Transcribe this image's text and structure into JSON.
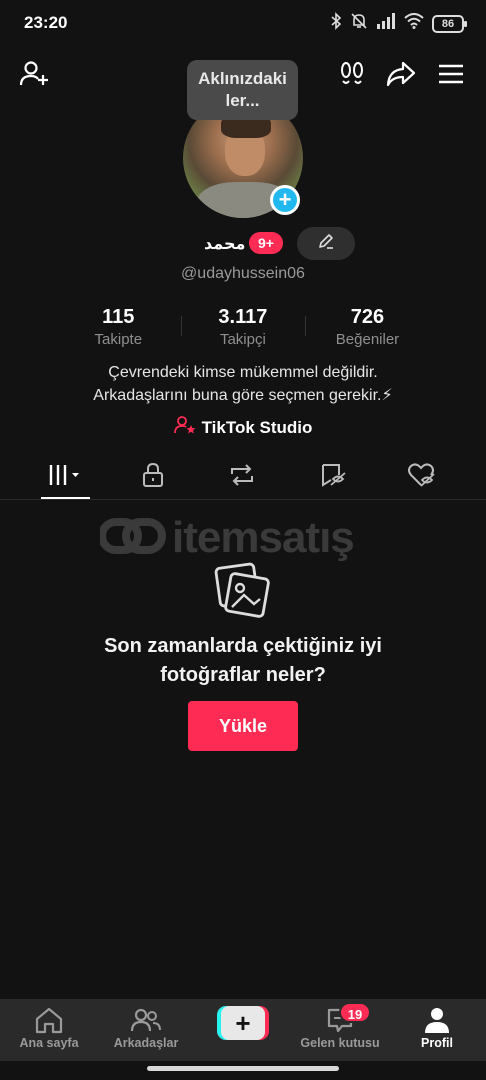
{
  "status_bar": {
    "time": "23:20",
    "battery": "86",
    "icons": [
      "bluetooth-icon",
      "mute-icon",
      "signal-icon",
      "wifi-icon",
      "battery-icon"
    ]
  },
  "header": {
    "tooltip": "Aklınızdaki ler...",
    "icons": [
      "add-friend-icon",
      "footprints-icon",
      "share-icon",
      "menu-icon"
    ]
  },
  "profile": {
    "display_name": "محمد",
    "name_badge": "9+",
    "username": "@udayhussein06"
  },
  "stats": [
    {
      "value": "115",
      "label": "Takipte"
    },
    {
      "value": "3.117",
      "label": "Takipçi"
    },
    {
      "value": "726",
      "label": "Beğeniler"
    }
  ],
  "bio": {
    "line1": "Çevrendeki kimse mükemmel değildir.",
    "line2": "Arkadaşlarını buna göre seçmen gerekir.⚡"
  },
  "studio": {
    "label": "TikTok Studio"
  },
  "tabs": [
    "videos-grid-tab",
    "private-tab",
    "reposts-tab",
    "favorites-tab",
    "liked-tab"
  ],
  "watermark": {
    "text": "itemsatış"
  },
  "empty_state": {
    "title_line1": "Son zamanlarda çektiğiniz iyi",
    "title_line2": "fotoğraflar neler?",
    "button": "Yükle"
  },
  "bottom_nav": {
    "items": [
      {
        "label": "Ana sayfa"
      },
      {
        "label": "Arkadaşlar"
      },
      {
        "label": ""
      },
      {
        "label": "Gelen kutusu"
      },
      {
        "label": "Profil"
      }
    ],
    "inbox_badge": "19"
  },
  "colors": {
    "accent": "#fe2c55",
    "cyan": "#25f4ee",
    "background": "#121212"
  }
}
